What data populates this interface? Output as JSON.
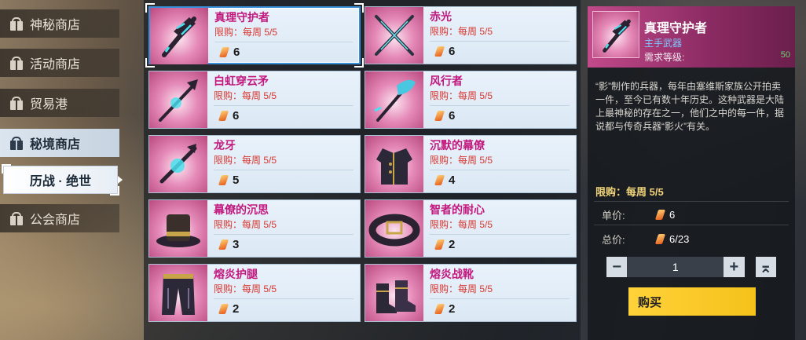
{
  "sidebar": {
    "items": [
      {
        "label": "神秘商店",
        "active": false
      },
      {
        "label": "活动商店",
        "active": false
      },
      {
        "label": "贸易港",
        "active": false
      },
      {
        "label": "秘境商店",
        "active": true
      },
      {
        "label": "公会商店",
        "active": false
      }
    ],
    "sub_tab": "历战 · 绝世"
  },
  "items": [
    {
      "name": "真理守护者",
      "limit": "限购：每周 5/5",
      "price": "6",
      "icon": "dagger-icon"
    },
    {
      "name": "赤光",
      "limit": "限购：每周 5/5",
      "price": "6",
      "icon": "crossed-swords-icon"
    },
    {
      "name": "白虹穿云矛",
      "limit": "限购：每周 5/5",
      "price": "6",
      "icon": "spear-icon"
    },
    {
      "name": "风行者",
      "limit": "限购：每周 5/5",
      "price": "6",
      "icon": "bow-icon"
    },
    {
      "name": "龙牙",
      "limit": "限购：每周 5/5",
      "price": "5",
      "icon": "blade-icon"
    },
    {
      "name": "沉默的幕僚",
      "limit": "限购：每周 5/5",
      "price": "4",
      "icon": "coat-icon"
    },
    {
      "name": "幕僚的沉思",
      "limit": "限购：每周 5/5",
      "price": "3",
      "icon": "hat-icon"
    },
    {
      "name": "智者的耐心",
      "limit": "限购：每周 5/5",
      "price": "2",
      "icon": "belt-icon"
    },
    {
      "name": "熔炎护腿",
      "limit": "限购：每周 5/5",
      "price": "2",
      "icon": "pants-icon"
    },
    {
      "name": "熔炎战靴",
      "limit": "限购：每周 5/5",
      "price": "2",
      "icon": "boots-icon"
    }
  ],
  "detail": {
    "name": "真理守护者",
    "type": "主手武器",
    "req_label": "需求等级:",
    "req_value": "50",
    "description": "“影”制作的兵器，每年由塞维斯家族公开拍卖一件，至今已有数十年历史。这种武器是大陆上最神秘的存在之一，他们之中的每一件，据说都与传奇兵器“影火”有关。",
    "limit": "限购：每周 5/5",
    "unit_price_label": "单价:",
    "unit_price": "6",
    "total_price_label": "总价:",
    "total_price": "6/23",
    "quantity": "1",
    "minus": "−",
    "plus": "+",
    "max": "⌅",
    "buy_label": "购买"
  },
  "colors": {
    "accent": "#3a8fd9",
    "item_name": "#c2187e",
    "limit": "#d9362f",
    "buy": "#f5c21a"
  }
}
